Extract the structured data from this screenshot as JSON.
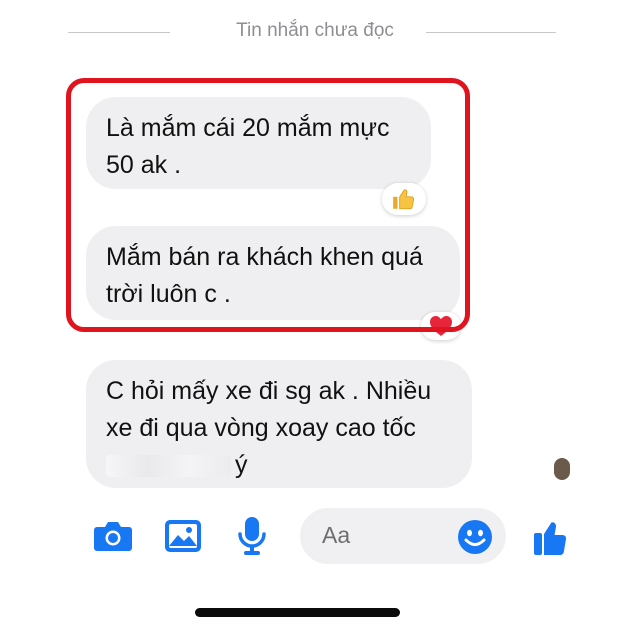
{
  "divider": {
    "label": "Tin nhắn chưa đọc"
  },
  "messages": [
    {
      "lines": [
        "Là mắm cái 20 mắm mực",
        "50 ak ."
      ],
      "reaction": "thumbs-up"
    },
    {
      "lines": [
        "Mắm bán ra khách khen quá",
        "trời luôn c ."
      ],
      "reaction": "heart"
    },
    {
      "lines": [
        "C hỏi mấy xe đi sg ak . Nhiều",
        "xe đi qua vòng xoay cao tốc",
        "ý"
      ],
      "note": "part of third line is blurred/redacted"
    }
  ],
  "composer": {
    "placeholder": "Aa",
    "icons": [
      "camera-icon",
      "gallery-icon",
      "microphone-icon",
      "emoji-icon",
      "like-icon"
    ]
  },
  "colors": {
    "accent": "#1877f2",
    "highlight": "#e0141e",
    "bubble": "#efeff1",
    "heart": "#e8253a"
  }
}
